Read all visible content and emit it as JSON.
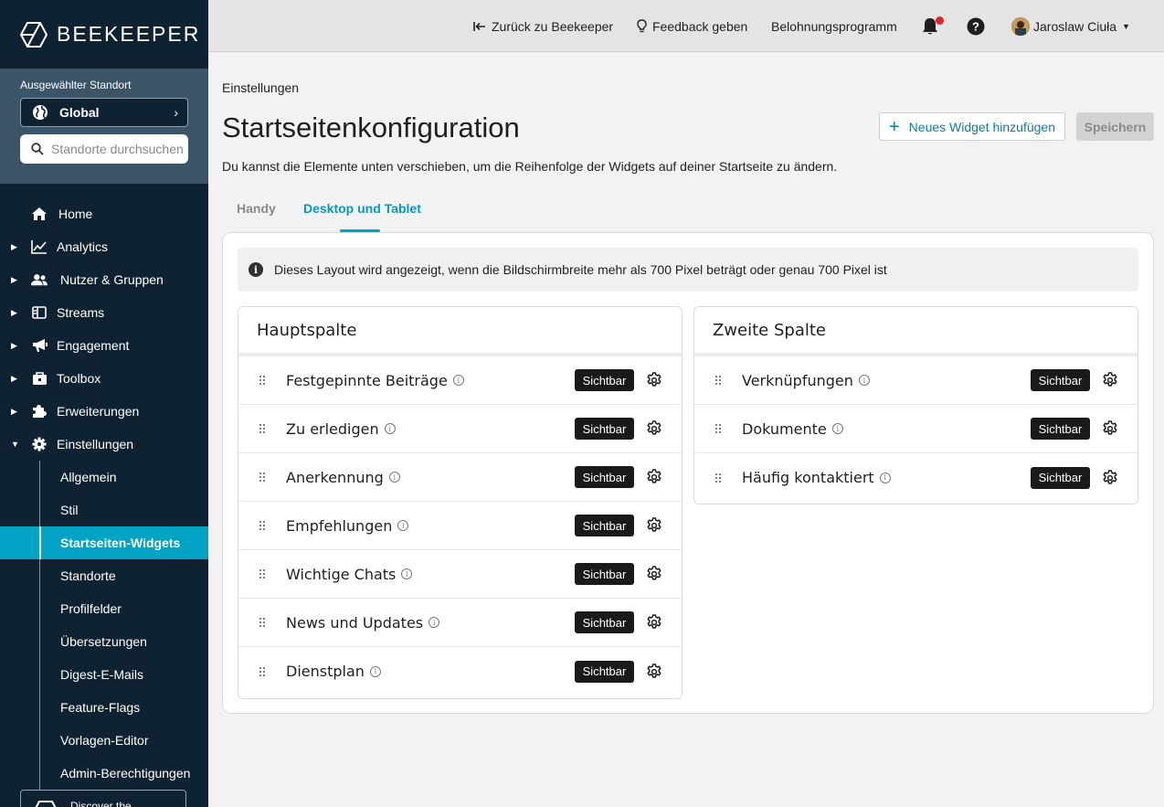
{
  "brand": {
    "name": "BEEKEEPER"
  },
  "location": {
    "label": "Ausgewählter Standort",
    "selected": "Global",
    "search_placeholder": "Standorte durchsuchen"
  },
  "nav": {
    "home": "Home",
    "analytics": "Analytics",
    "users": "Nutzer & Gruppen",
    "streams": "Streams",
    "engagement": "Engagement",
    "toolbox": "Toolbox",
    "extensions": "Erweiterungen",
    "settings": "Einstellungen",
    "sub": [
      "Allgemein",
      "Stil",
      "Startseiten-Widgets",
      "Standorte",
      "Profilfelder",
      "Übersetzungen",
      "Digest-E-Mails",
      "Feature-Flags",
      "Vorlagen-Editor",
      "Admin-Berechtigungen"
    ],
    "discover": "Discover the"
  },
  "topbar": {
    "back": "Zurück zu Beekeeper",
    "feedback": "Feedback geben",
    "rewards": "Belohnungsprogramm",
    "user": "Jaroslaw Ciuła"
  },
  "page": {
    "breadcrumb": "Einstellungen",
    "title": "Startseitenkonfiguration",
    "description": "Du kannst die Elemente unten verschieben, um die Reihenfolge der Widgets auf deiner Startseite zu ändern.",
    "add_button": "Neues Widget hinzufügen",
    "save_button": "Speichern",
    "tabs": [
      "Handy",
      "Desktop und Tablet"
    ],
    "info": "Dieses Layout wird angezeigt, wenn die Bildschirmbreite mehr als 700 Pixel beträgt oder genau 700 Pixel ist"
  },
  "main_column": {
    "title": "Hauptspalte",
    "widgets": [
      {
        "name": "Festgepinnte Beiträge",
        "status": "Sichtbar"
      },
      {
        "name": "Zu erledigen",
        "status": "Sichtbar"
      },
      {
        "name": "Anerkennung",
        "status": "Sichtbar"
      },
      {
        "name": "Empfehlungen",
        "status": "Sichtbar"
      },
      {
        "name": "Wichtige Chats",
        "status": "Sichtbar"
      },
      {
        "name": "News und Updates",
        "status": "Sichtbar"
      },
      {
        "name": "Dienstplan",
        "status": "Sichtbar"
      }
    ]
  },
  "second_column": {
    "title": "Zweite Spalte",
    "widgets": [
      {
        "name": "Verknüpfungen",
        "status": "Sichtbar"
      },
      {
        "name": "Dokumente",
        "status": "Sichtbar"
      },
      {
        "name": "Häufig kontaktiert",
        "status": "Sichtbar"
      }
    ]
  },
  "colors": {
    "accent": "#00a3c4",
    "sidebar": "#0f2232",
    "badge": "#1a1a1a",
    "notification": "#e0242f"
  }
}
